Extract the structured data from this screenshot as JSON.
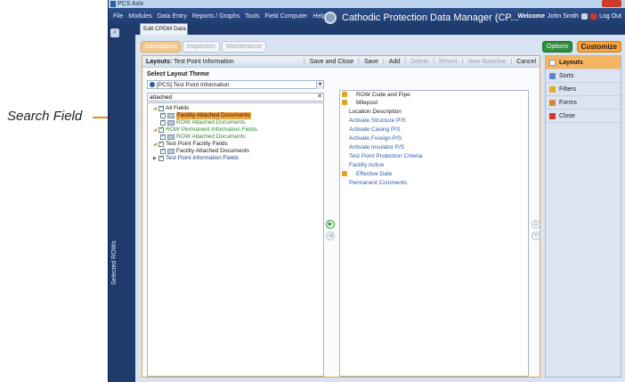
{
  "callout": {
    "label": "Search Field"
  },
  "window": {
    "title": "PCS Axis"
  },
  "menubar": {
    "items": [
      "File",
      "Modules",
      "Data Entry",
      "Reports / Graphs",
      "Tools",
      "Field Computer",
      "Help"
    ],
    "app_title": "Cathodic Protection Data Manager (CP...",
    "welcome_label": "Welcome",
    "user": "John Smith",
    "logout": "Log Out"
  },
  "sidebar": {
    "selected_rows_label": "Selected ROWs"
  },
  "doc_tab": {
    "label": "Edit CPDM Data"
  },
  "subtabs": [
    "Information",
    "Inspection",
    "Maintenance"
  ],
  "header_buttons": {
    "options": "Options",
    "customize": "Customize"
  },
  "toolbar": {
    "layouts_label": "Layouts:",
    "layouts_value": "Test Point Information",
    "save_close": "Save and Close",
    "save": "Save",
    "add": "Add",
    "delete": "Delete",
    "revert": "Revert",
    "new_baseline": "New Baseline",
    "cancel": "Cancel"
  },
  "theme": {
    "title": "Select Layout Theme",
    "selected": "[PCS] Test Point Information"
  },
  "search": {
    "value": "attached"
  },
  "tree": [
    {
      "label": "All Fields",
      "style": "dark"
    },
    {
      "label": "Facility Attached Documents",
      "style": "hl"
    },
    {
      "label": "ROW Attached Documents",
      "style": "green"
    },
    {
      "label": "ROW Permanent Information Fields",
      "style": "green"
    },
    {
      "label": "ROW Attached Documents",
      "style": "green"
    },
    {
      "label": "Test Point Facility Fields",
      "style": "dark"
    },
    {
      "label": "Facility Attached Documents",
      "style": "dark"
    },
    {
      "label": "Test Point Information Fields",
      "style": "blue"
    }
  ],
  "fields": [
    {
      "label": "ROW Code and Pipe",
      "style": "dark"
    },
    {
      "label": "Milepost",
      "style": "dark"
    },
    {
      "label": "Location Description",
      "style": "dark"
    },
    {
      "label": "Activate Structure P/S",
      "style": "link"
    },
    {
      "label": "Activate Casing P/S",
      "style": "link"
    },
    {
      "label": "Activate Foreign P/S",
      "style": "link"
    },
    {
      "label": "Activate Insulator P/S",
      "style": "link"
    },
    {
      "label": "Test Point Protection Criteria",
      "style": "link"
    },
    {
      "label": "Facility Active",
      "style": "link"
    },
    {
      "label": "Effective Date",
      "style": "link"
    },
    {
      "label": "Permanent Comments",
      "style": "link"
    }
  ],
  "sidenav": [
    "Layouts",
    "Sorts",
    "Filters",
    "Forms",
    "Close"
  ],
  "colors": {
    "accent": "#f08a1c",
    "navy": "#1f3b6c",
    "highlight": "#f4a23a"
  }
}
